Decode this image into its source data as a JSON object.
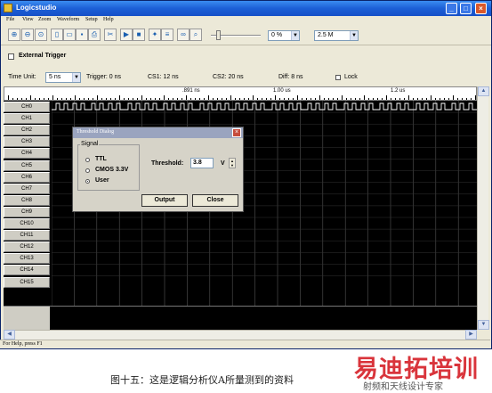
{
  "window": {
    "title": "Logicstudio",
    "controls": [
      "_",
      "□",
      "×"
    ]
  },
  "menu": [
    "File",
    "View",
    "Zoom",
    "Waveform",
    "Setup",
    "Help"
  ],
  "toolbar": {
    "icons": [
      "zoom-in-icon",
      "zoom-out-icon",
      "zoom-fit-icon",
      "new-file-icon",
      "open-folder-icon",
      "save-icon",
      "print-icon",
      "tool-icon",
      "run-icon",
      "stop-icon",
      "trigger-icon",
      "channel-icon",
      "binoculars-icon",
      "search-icon"
    ],
    "zoom_percent": "0 %",
    "sample_rate": "2.5 M"
  },
  "trigger": {
    "external_trigger_label": "External Trigger"
  },
  "info": {
    "time_unit_label": "Time Unit:",
    "time_unit_value": "5 ns",
    "trigger": "Trigger: 0 ns",
    "cs1": "CS1: 12 ns",
    "cs2": "CS2: 20 ns",
    "diff": "Diff: 8 ns",
    "lock": "Lock"
  },
  "ruler": {
    "labels": [
      ".891 ns",
      "1.00 us",
      "1.2 us"
    ]
  },
  "channels": [
    "CH0",
    "CH1",
    "CH2",
    "CH3",
    "CH4",
    "CH5",
    "CH6",
    "CH7",
    "CH8",
    "CH9",
    "CH10",
    "CH11",
    "CH12",
    "CH13",
    "CH14",
    "CH15"
  ],
  "dialog": {
    "title": "Threshold Dialog",
    "signal_group": "Signal",
    "options": [
      "TTL",
      "CMOS 3.3V",
      "User"
    ],
    "selected": "User",
    "threshold_label": "Threshold:",
    "threshold_value": "3.8",
    "unit": "V",
    "output_button": "Output",
    "close_button": "Close"
  },
  "status": {
    "text": "For Help, press F1"
  },
  "caption": {
    "text": "图十五：这是逻辑分析仪A所量测到的资料",
    "watermark_main": "易迪拓培训",
    "watermark_sub": "射频和天线设计专家"
  },
  "colors": {
    "waveform_bg": "#000000",
    "waveform_signal": "#ffffff",
    "titlebar": "#1c5fd6",
    "watermark": "#d9343b"
  }
}
